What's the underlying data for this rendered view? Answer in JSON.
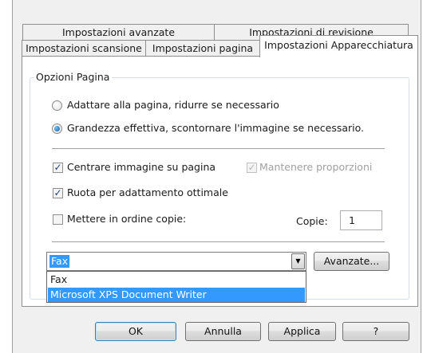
{
  "tabs": {
    "row_back": [
      "Impostazioni avanzate",
      "Impostazioni di revisione"
    ],
    "row_front": [
      "Impostazioni scansione",
      "Impostazioni pagina",
      "Impostazioni Apparecchiatura"
    ],
    "active": "Impostazioni Apparecchiatura"
  },
  "group": {
    "title": "Opzioni Pagina"
  },
  "options": {
    "radio_fit": {
      "label": "Adattare alla pagina, ridurre se necessario",
      "checked": false
    },
    "radio_actual": {
      "label": "Grandezza effettiva, scontornare l'immagine se necessario.",
      "checked": true
    },
    "center_image": {
      "label": "Centrare immagine su pagina",
      "checked": true
    },
    "keep_proportions": {
      "label": "Mantenere proporzioni",
      "checked": true,
      "enabled": false
    },
    "rotate_fit": {
      "label": "Ruota per adattamento ottimale",
      "checked": true
    },
    "collate": {
      "label": "Mettere in ordine copie:",
      "checked": false
    }
  },
  "copies": {
    "label": "Copie:",
    "value": "1"
  },
  "printer": {
    "selected": "Fax",
    "options": [
      "Fax",
      "Microsoft XPS Document Writer"
    ],
    "highlighted": "Microsoft XPS Document Writer"
  },
  "buttons": {
    "advanced": "Avanzate...",
    "ok": "OK",
    "cancel": "Annulla",
    "apply": "Applica",
    "help": "?"
  },
  "glyphs": {
    "check": "✓",
    "arrow_down": "▼"
  },
  "colors": {
    "selection": "#3399ff",
    "default_button_border": "#3c7fb1"
  }
}
